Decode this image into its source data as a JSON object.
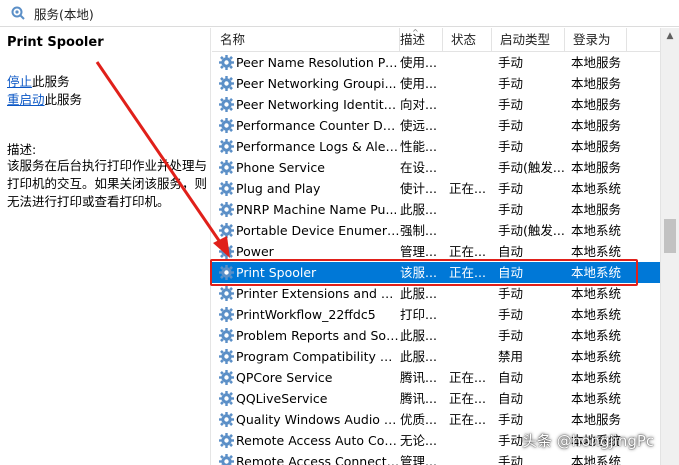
{
  "window": {
    "title": "服务(本地)"
  },
  "left_panel": {
    "service_title": "Print Spooler",
    "stop_link": "停止",
    "stop_suffix": "此服务",
    "restart_link": "重启动",
    "restart_suffix": "此服务",
    "description_label": "描述:",
    "description_lines": [
      "该服务在后台执行打印作业并处理与",
      "打印机的交互。如果关闭该服务，则",
      "无法进行打印或查看打印机。"
    ]
  },
  "table": {
    "columns": [
      "名称",
      "描述",
      "状态",
      "启动类型",
      "登录为"
    ],
    "rows": [
      {
        "name": "Peer Name Resolution Pr...",
        "desc": "使用...",
        "status": "",
        "startup": "手动",
        "logon": "本地服务"
      },
      {
        "name": "Peer Networking Groupi...",
        "desc": "使用...",
        "status": "",
        "startup": "手动",
        "logon": "本地服务"
      },
      {
        "name": "Peer Networking Identity...",
        "desc": "向对...",
        "status": "",
        "startup": "手动",
        "logon": "本地服务"
      },
      {
        "name": "Performance Counter DL...",
        "desc": "使远...",
        "status": "",
        "startup": "手动",
        "logon": "本地服务"
      },
      {
        "name": "Performance Logs & Aler...",
        "desc": "性能...",
        "status": "",
        "startup": "手动",
        "logon": "本地服务"
      },
      {
        "name": "Phone Service",
        "desc": "在设...",
        "status": "",
        "startup": "手动(触发...",
        "logon": "本地服务"
      },
      {
        "name": "Plug and Play",
        "desc": "使计...",
        "status": "正在...",
        "startup": "手动",
        "logon": "本地系统"
      },
      {
        "name": "PNRP Machine Name Pu...",
        "desc": "此服...",
        "status": "",
        "startup": "手动",
        "logon": "本地服务"
      },
      {
        "name": "Portable Device Enumera...",
        "desc": "强制...",
        "status": "",
        "startup": "手动(触发...",
        "logon": "本地系统"
      },
      {
        "name": "Power",
        "desc": "管理...",
        "status": "正在...",
        "startup": "自动",
        "logon": "本地系统"
      },
      {
        "name": "Print Spooler",
        "desc": "该服...",
        "status": "正在...",
        "startup": "自动",
        "logon": "本地系统",
        "selected": true
      },
      {
        "name": "Printer Extensions and N...",
        "desc": "此服...",
        "status": "",
        "startup": "手动",
        "logon": "本地系统"
      },
      {
        "name": "PrintWorkflow_22ffdc5",
        "desc": "打印...",
        "status": "",
        "startup": "手动",
        "logon": "本地系统"
      },
      {
        "name": "Problem Reports and Sol...",
        "desc": "此服...",
        "status": "",
        "startup": "手动",
        "logon": "本地系统"
      },
      {
        "name": "Program Compatibility A...",
        "desc": "此服...",
        "status": "",
        "startup": "禁用",
        "logon": "本地系统"
      },
      {
        "name": "QPCore Service",
        "desc": "腾讯...",
        "status": "正在...",
        "startup": "自动",
        "logon": "本地系统"
      },
      {
        "name": "QQLiveService",
        "desc": "腾讯...",
        "status": "正在...",
        "startup": "自动",
        "logon": "本地系统"
      },
      {
        "name": "Quality Windows Audio V...",
        "desc": "优质...",
        "status": "正在...",
        "startup": "手动",
        "logon": "本地服务"
      },
      {
        "name": "Remote Access Auto Con...",
        "desc": "无论...",
        "status": "",
        "startup": "手动",
        "logon": "本地系统"
      },
      {
        "name": "Remote Access Connecti...",
        "desc": "管理...",
        "status": "",
        "startup": "手动",
        "logon": "本地系统"
      }
    ]
  },
  "watermark": "头条 @hongjingPc",
  "colors": {
    "selection": "#0078d7",
    "highlight": "#e0201a",
    "link": "#0b57c5",
    "gear": "#5b8fc7"
  }
}
